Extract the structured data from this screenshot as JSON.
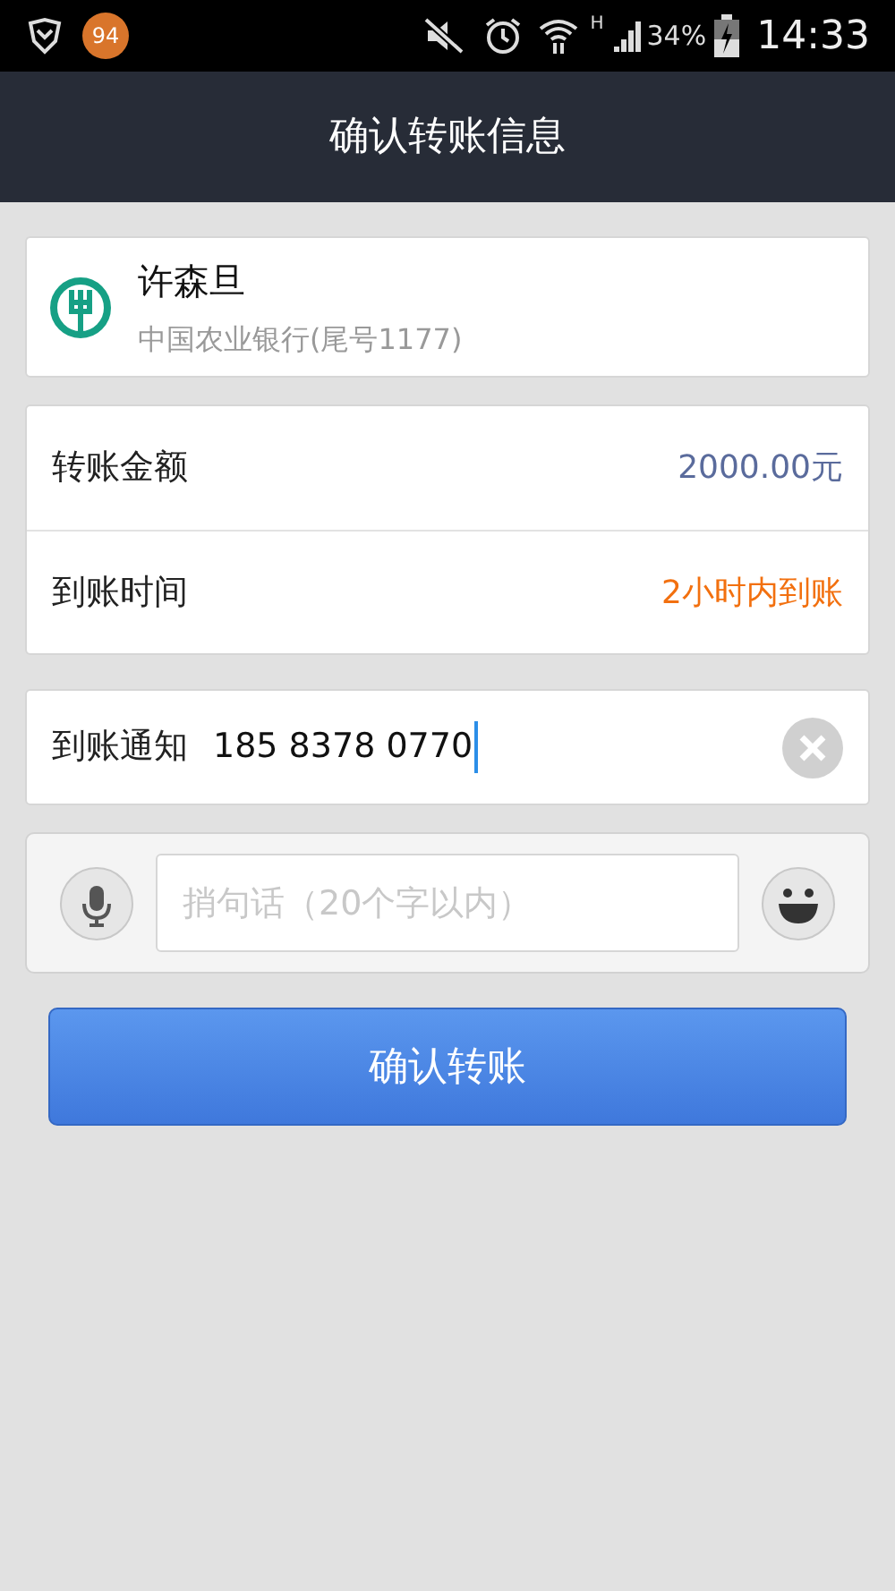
{
  "status_bar": {
    "badge": "94",
    "network": "H",
    "battery": "34%",
    "time": "14:33"
  },
  "header": {
    "title": "确认转账信息"
  },
  "payee": {
    "name": "许森旦",
    "bank": "中国农业银行(尾号1177)"
  },
  "details": [
    {
      "label": "转账金额",
      "value": "2000.00元",
      "color": "#5a6b9c"
    },
    {
      "label": "到账时间",
      "value": "2小时内到账",
      "color": "#f2700f"
    }
  ],
  "notice": {
    "label": "到账通知",
    "value": "185 8378 0770"
  },
  "message": {
    "placeholder": "捎句话（20个字以内）"
  },
  "confirm_button": "确认转账"
}
